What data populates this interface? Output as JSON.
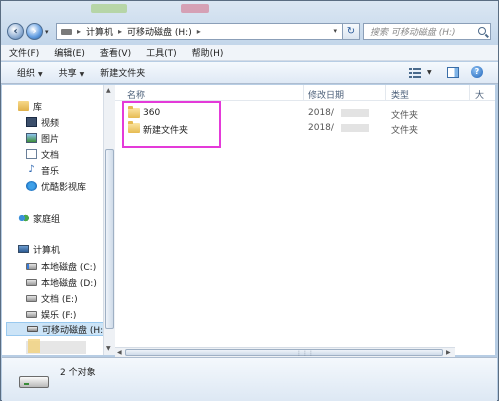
{
  "address": {
    "path": [
      "计算机",
      "可移动磁盘 (H:)"
    ],
    "search_placeholder": "搜索 可移动磁盘 (H:)"
  },
  "menu": [
    "文件(F)",
    "编辑(E)",
    "查看(V)",
    "工具(T)",
    "帮助(H)"
  ],
  "toolbar": {
    "organize": "组织",
    "share": "共享",
    "new_folder": "新建文件夹"
  },
  "nav": {
    "library": "库",
    "library_items": [
      "视频",
      "图片",
      "文档",
      "音乐",
      "优酷影视库"
    ],
    "homegroup": "家庭组",
    "computer": "计算机",
    "drives": [
      "本地磁盘 (C:)",
      "本地磁盘 (D:)",
      "文档 (E:)",
      "娱乐 (F:)",
      "可移动磁盘 (H:)"
    ]
  },
  "columns": [
    "名称",
    "修改日期",
    "类型",
    "大"
  ],
  "files": [
    {
      "name": "360",
      "date": "2018/",
      "type": "文件夹"
    },
    {
      "name": "新建文件夹",
      "date": "2018/",
      "type": "文件夹"
    }
  ],
  "status": {
    "count": "2 个对象"
  },
  "colors": {
    "highlight": "#e43ad9",
    "selection": "#cce4f7"
  }
}
